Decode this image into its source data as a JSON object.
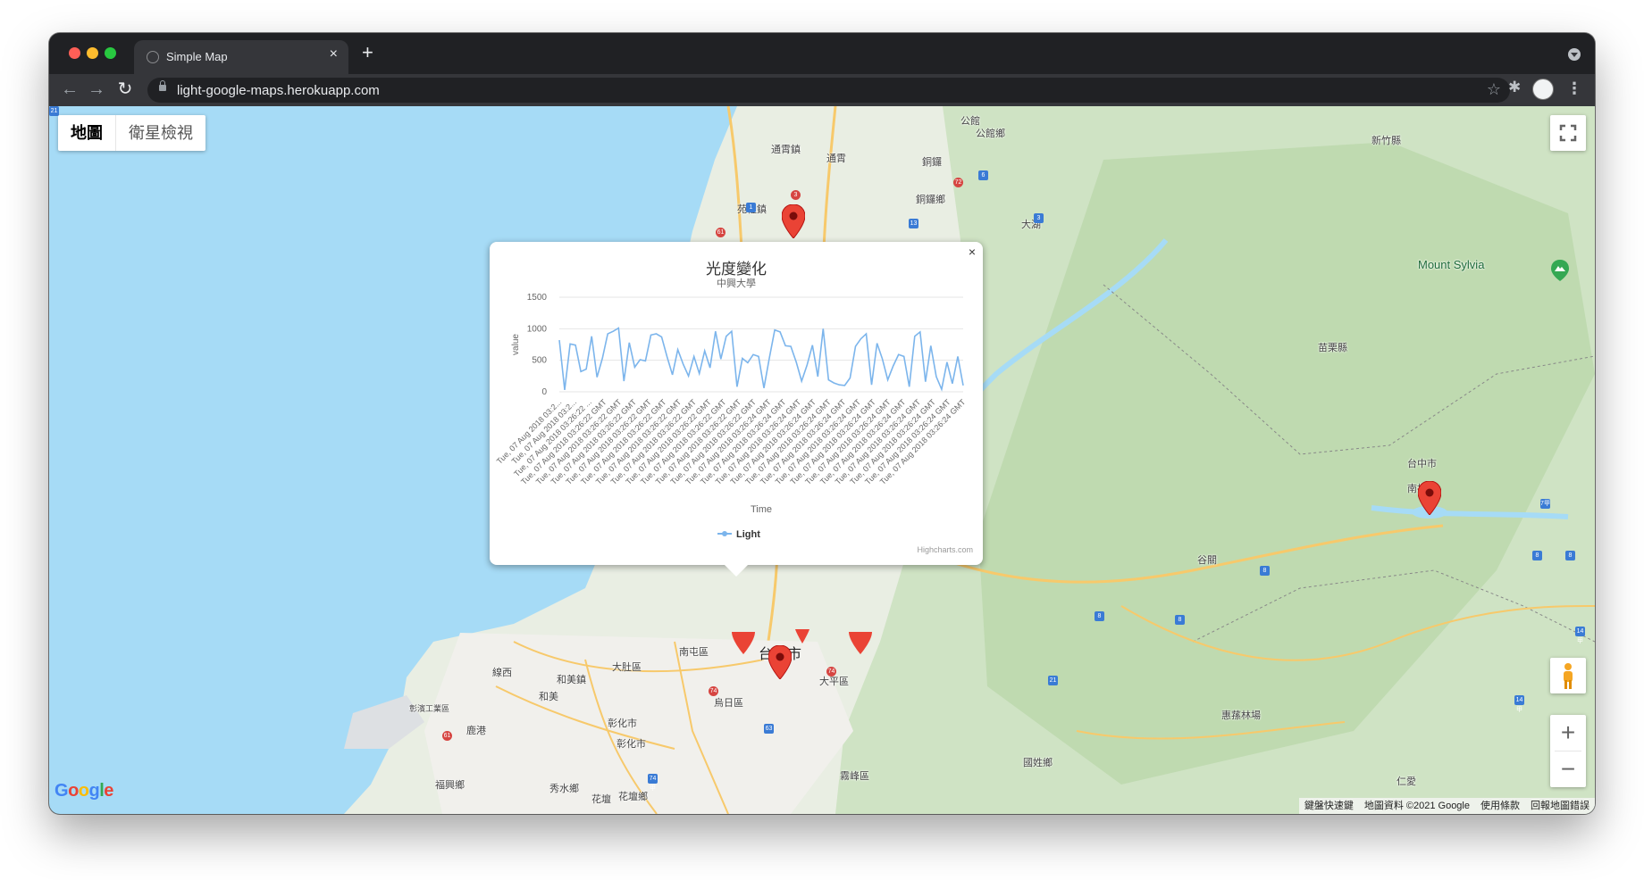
{
  "browser": {
    "tab_title": "Simple Map",
    "url": "light-google-maps.herokuapp.com"
  },
  "map": {
    "map_type_options": [
      "地圖",
      "衛星檢視"
    ],
    "active_map_type": "地圖",
    "places": [
      {
        "name": "公館",
        "kind": "town"
      },
      {
        "name": "公館鄉",
        "kind": "town"
      },
      {
        "name": "通霄鎮",
        "kind": "town"
      },
      {
        "name": "通霄",
        "kind": "town"
      },
      {
        "name": "銅鑼",
        "kind": "town"
      },
      {
        "name": "銅鑼鄉",
        "kind": "town"
      },
      {
        "name": "苑裡鎮",
        "kind": "town"
      },
      {
        "name": "大湖",
        "kind": "town"
      },
      {
        "name": "新竹縣",
        "kind": "county"
      },
      {
        "name": "苗栗縣",
        "kind": "county"
      },
      {
        "name": "Mount Sylvia",
        "kind": "mountain"
      },
      {
        "name": "台中市",
        "kind": "city"
      },
      {
        "name": "南投縣",
        "kind": "county"
      },
      {
        "name": "台中市",
        "kind": "city-big"
      },
      {
        "name": "南屯區",
        "kind": "district"
      },
      {
        "name": "大肚區",
        "kind": "district"
      },
      {
        "name": "線西",
        "kind": "town"
      },
      {
        "name": "和美鎮",
        "kind": "town"
      },
      {
        "name": "和美",
        "kind": "town"
      },
      {
        "name": "大平區",
        "kind": "district"
      },
      {
        "name": "烏日區",
        "kind": "district"
      },
      {
        "name": "彰化市",
        "kind": "city"
      },
      {
        "name": "彰化市",
        "kind": "city"
      },
      {
        "name": "鹿港",
        "kind": "town"
      },
      {
        "name": "福興鄉",
        "kind": "town"
      },
      {
        "name": "秀水鄉",
        "kind": "town"
      },
      {
        "name": "花壇",
        "kind": "town"
      },
      {
        "name": "花壇鄉",
        "kind": "town"
      },
      {
        "name": "霧峰區",
        "kind": "district"
      },
      {
        "name": "惠蓀林場",
        "kind": "poi"
      },
      {
        "name": "國姓鄉",
        "kind": "town"
      },
      {
        "name": "仁愛",
        "kind": "town"
      },
      {
        "name": "谷關",
        "kind": "town"
      },
      {
        "name": "彰濱工業區",
        "kind": "poi"
      }
    ],
    "logo_text": "Google",
    "attribution": [
      "鍵盤快速鍵",
      "地圖資料 ©2021 Google",
      "使用條款",
      "回報地圖錯誤"
    ],
    "zoom_in": "+",
    "zoom_out": "−"
  },
  "info_window": {
    "close_label": "×",
    "credits": "Highcharts.com"
  },
  "chart_data": {
    "type": "line",
    "title": "光度變化",
    "subtitle": "中興大學",
    "xlabel": "Time",
    "ylabel": "value",
    "ylim": [
      0,
      1500
    ],
    "yticks": [
      "0",
      "500",
      "1000",
      "1500"
    ],
    "grid": true,
    "legend": "bottom",
    "color": "#7cb5ec",
    "categories": [
      "Tue, 07 Aug 2018 03:2...",
      "Tue, 07 Aug 2018 03:2...",
      "Tue, 07 Aug 2018 03:26:22 ...",
      "Tue, 07 Aug 2018 03:26:22 GMT",
      "Tue, 07 Aug 2018 03:26:22 GMT",
      "Tue, 07 Aug 2018 03:26:22 GMT",
      "Tue, 07 Aug 2018 03:26:22 GMT",
      "Tue, 07 Aug 2018 03:26:22 GMT",
      "Tue, 07 Aug 2018 03:26:22 GMT",
      "Tue, 07 Aug 2018 03:26:22 GMT",
      "Tue, 07 Aug 2018 03:26:22 GMT",
      "Tue, 07 Aug 2018 03:26:22 GMT",
      "Tue, 07 Aug 2018 03:26:22 GMT",
      "Tue, 07 Aug 2018 03:26:22 GMT",
      "Tue, 07 Aug 2018 03:26:24 GMT",
      "Tue, 07 Aug 2018 03:26:24 GMT",
      "Tue, 07 Aug 2018 03:26:24 GMT",
      "Tue, 07 Aug 2018 03:26:24 GMT",
      "Tue, 07 Aug 2018 03:26:24 GMT",
      "Tue, 07 Aug 2018 03:26:24 GMT",
      "Tue, 07 Aug 2018 03:26:24 GMT",
      "Tue, 07 Aug 2018 03:26:24 GMT",
      "Tue, 07 Aug 2018 03:26:24 GMT",
      "Tue, 07 Aug 2018 03:26:24 GMT",
      "Tue, 07 Aug 2018 03:26:24 GMT",
      "Tue, 07 Aug 2018 03:26:24 GMT",
      "Tue, 07 Aug 2018 03:26:24 GMT",
      "Tue, 07 Aug 2018 03:26:24 GMT"
    ],
    "series": [
      {
        "name": "Light",
        "values": [
          820,
          30,
          760,
          740,
          320,
          360,
          880,
          230,
          530,
          920,
          960,
          1010,
          170,
          780,
          390,
          510,
          490,
          900,
          920,
          870,
          560,
          270,
          670,
          440,
          250,
          560,
          290,
          650,
          380,
          960,
          520,
          880,
          960,
          80,
          530,
          460,
          590,
          560,
          60,
          530,
          980,
          950,
          730,
          720,
          470,
          170,
          420,
          740,
          240,
          1000,
          190,
          140,
          110,
          100,
          220,
          720,
          840,
          920,
          110,
          770,
          520,
          190,
          410,
          590,
          560,
          80,
          880,
          950,
          160,
          730,
          240,
          40,
          470,
          130,
          560,
          100
        ]
      }
    ]
  }
}
